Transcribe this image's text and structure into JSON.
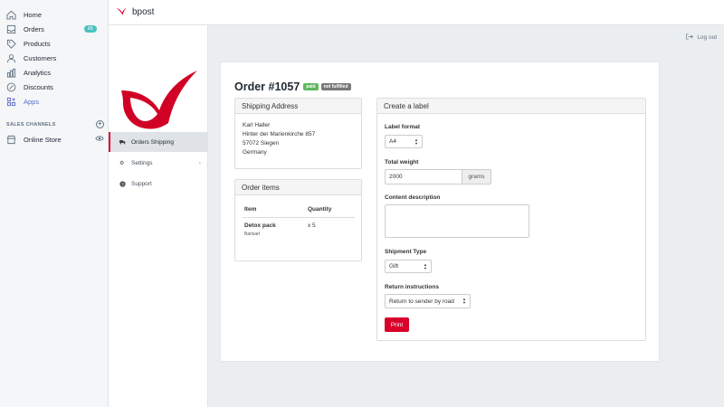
{
  "nav": {
    "items": [
      {
        "label": "Home",
        "icon": "home-icon"
      },
      {
        "label": "Orders",
        "icon": "orders-icon",
        "badge": "65"
      },
      {
        "label": "Products",
        "icon": "tag-icon"
      },
      {
        "label": "Customers",
        "icon": "person-icon"
      },
      {
        "label": "Analytics",
        "icon": "bar-chart-icon"
      },
      {
        "label": "Discounts",
        "icon": "discount-icon"
      },
      {
        "label": "Apps",
        "icon": "apps-icon"
      }
    ],
    "sales_channels_label": "SALES CHANNELS",
    "online_store_label": "Online Store"
  },
  "topbar": {
    "brand": "bpost"
  },
  "app_nav": {
    "orders_shipping": "Orders Shipping",
    "settings": "Settings",
    "support": "Support"
  },
  "logout_label": "Log out",
  "order": {
    "title": "Order #1057",
    "status_paid": "paid",
    "status_fulfillment": "not fulfilled"
  },
  "shipping": {
    "heading": "Shipping Address",
    "lines": [
      "Karl Haller",
      "Hinter der Marienkirche 857",
      "57072 Siegen",
      "Germany"
    ]
  },
  "items": {
    "heading": "Order items",
    "col_item": "Item",
    "col_quantity": "Quantity",
    "rows": [
      {
        "name": "Detox pack",
        "vendor": "Barisart",
        "quantity": "x 5"
      }
    ]
  },
  "label_form": {
    "heading": "Create a label",
    "label_format_label": "Label format",
    "label_format_value": "A4",
    "total_weight_label": "Total weight",
    "total_weight_value": "2000",
    "weight_unit": "grams",
    "content_description_label": "Content description",
    "content_description_value": "",
    "shipment_type_label": "Shipment Type",
    "shipment_type_value": "Gift",
    "return_instructions_label": "Return instructions",
    "return_instructions_value": "Return to sender by road",
    "print_label": "Print"
  },
  "colors": {
    "accent": "#e0002b",
    "apps_active": "#5c6ac4",
    "badge": "#47c1bf",
    "paid": "#5cb85c",
    "not_fulfilled": "#777777"
  }
}
